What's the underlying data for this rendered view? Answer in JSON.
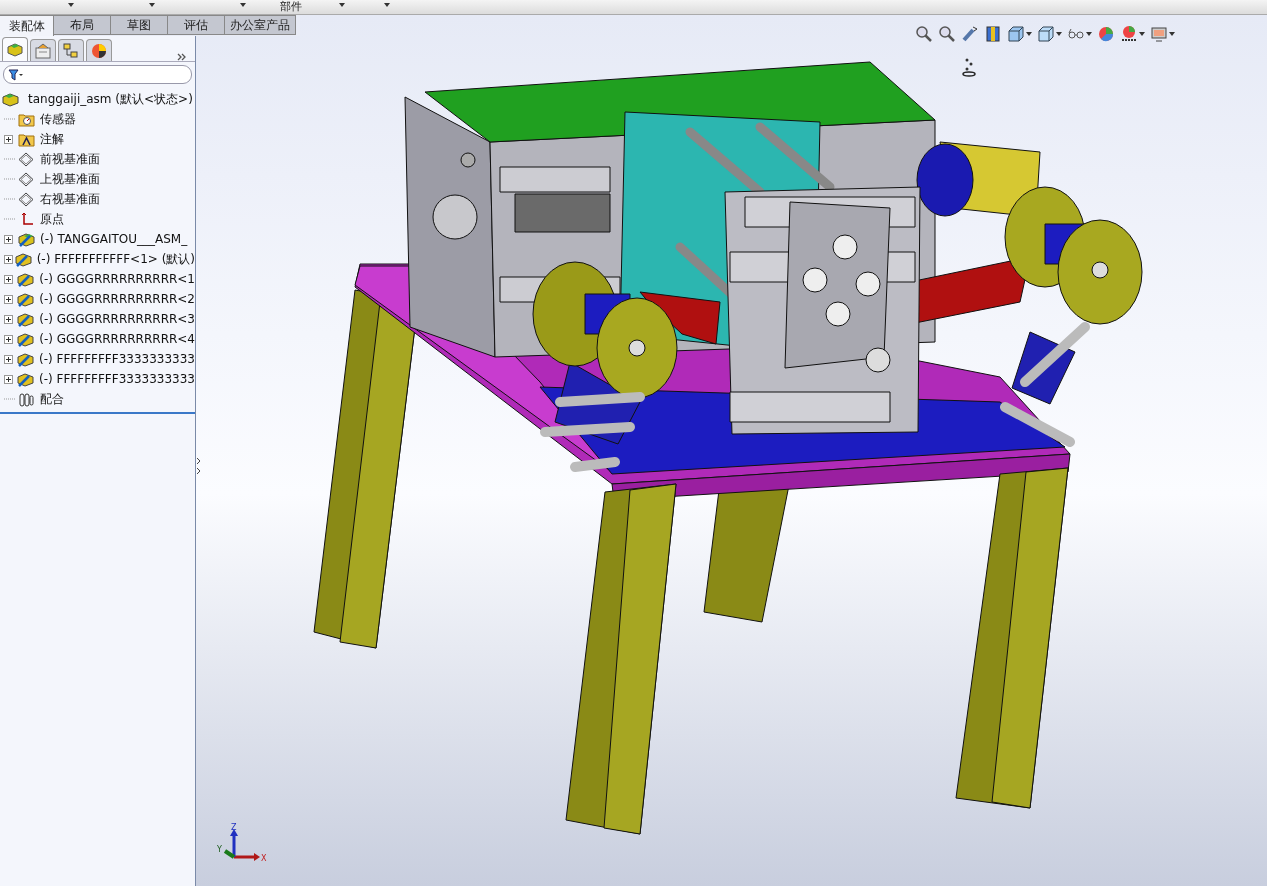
{
  "command_manager": {
    "label": "部件"
  },
  "tabs": [
    {
      "label": "装配体",
      "selected": true
    },
    {
      "label": "布局",
      "selected": false
    },
    {
      "label": "草图",
      "selected": false
    },
    {
      "label": "评估",
      "selected": false
    },
    {
      "label": "办公室产品",
      "selected": false
    }
  ],
  "panel_tabs": [
    {
      "kind": "feature-tree",
      "selected": true
    },
    {
      "kind": "property-manager",
      "selected": false
    },
    {
      "kind": "configuration-manager",
      "selected": false
    },
    {
      "kind": "display-manager",
      "selected": false
    }
  ],
  "feature_tree": {
    "root": {
      "label": "tanggaiji_asm  (默认<状态>)",
      "kind": "assembly",
      "children": [
        {
          "label": "传感器",
          "kind": "sensors",
          "expandable": false
        },
        {
          "label": "注解",
          "kind": "annotations",
          "expandable": true
        },
        {
          "label": "前视基准面",
          "kind": "plane",
          "expandable": false
        },
        {
          "label": "上视基准面",
          "kind": "plane",
          "expandable": false
        },
        {
          "label": "右视基准面",
          "kind": "plane",
          "expandable": false
        },
        {
          "label": "原点",
          "kind": "origin",
          "expandable": false
        },
        {
          "label": "(-) TANGGAITOU___ASM_",
          "kind": "subassembly",
          "expandable": true
        },
        {
          "label": "(-) FFFFFFFFFFF<1> (默认)",
          "kind": "component",
          "expandable": true
        },
        {
          "label": "(-) GGGGRRRRRRRRRR<1",
          "kind": "component",
          "expandable": true
        },
        {
          "label": "(-) GGGGRRRRRRRRRR<2",
          "kind": "component",
          "expandable": true
        },
        {
          "label": "(-) GGGGRRRRRRRRRR<3",
          "kind": "component",
          "expandable": true
        },
        {
          "label": "(-) GGGGRRRRRRRRRR<4",
          "kind": "component",
          "expandable": true
        },
        {
          "label": "(-) FFFFFFFFF3333333333",
          "kind": "component",
          "expandable": true
        },
        {
          "label": "(-) FFFFFFFFF3333333333",
          "kind": "component",
          "expandable": true
        },
        {
          "label": "配合",
          "kind": "mates",
          "expandable": false
        }
      ]
    }
  },
  "triad": {
    "x": "X",
    "y": "Y",
    "z": "Z"
  }
}
